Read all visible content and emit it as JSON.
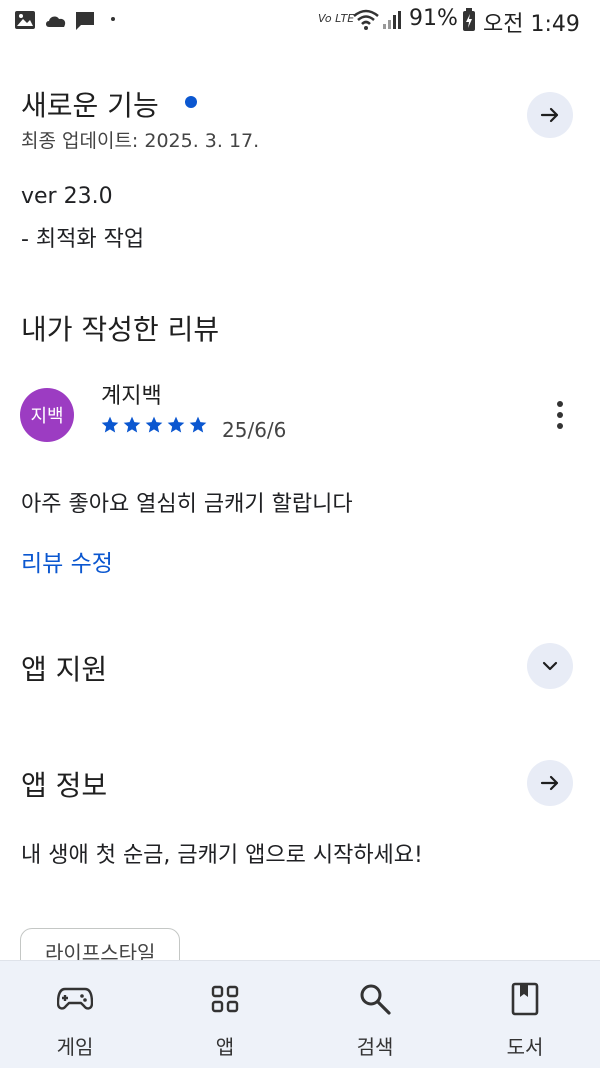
{
  "status_bar": {
    "network": "Vo LTE",
    "battery": "91%",
    "time": "오전 1:49"
  },
  "whats_new": {
    "title": "새로운 기능",
    "updated": "최종 업데이트: 2025. 3. 17.",
    "version": "ver 23.0",
    "note": "- 최적화 작업"
  },
  "my_review": {
    "title": "내가 작성한 리뷰",
    "avatar_text": "지백",
    "reviewer": "계지백",
    "rating": 5,
    "date": "25/6/6",
    "text": "아주 좋아요 열심히 금캐기 할랍니다",
    "edit_link": "리뷰 수정"
  },
  "app_support": {
    "title": "앱 지원"
  },
  "app_info": {
    "title": "앱 정보",
    "description": "내 생애 첫 순금, 금캐기 앱으로 시작하세요!",
    "chip": "라이프스타일"
  },
  "bottom_nav": [
    {
      "label": "게임",
      "icon": "gamepad-icon"
    },
    {
      "label": "앱",
      "icon": "apps-grid-icon"
    },
    {
      "label": "검색",
      "icon": "search-icon"
    },
    {
      "label": "도서",
      "icon": "book-icon"
    }
  ],
  "colors": {
    "accent": "#0b57d0",
    "avatar_bg": "#9c3cc2",
    "button_bg": "#e8ecf6",
    "nav_bg": "#eef2f9"
  }
}
